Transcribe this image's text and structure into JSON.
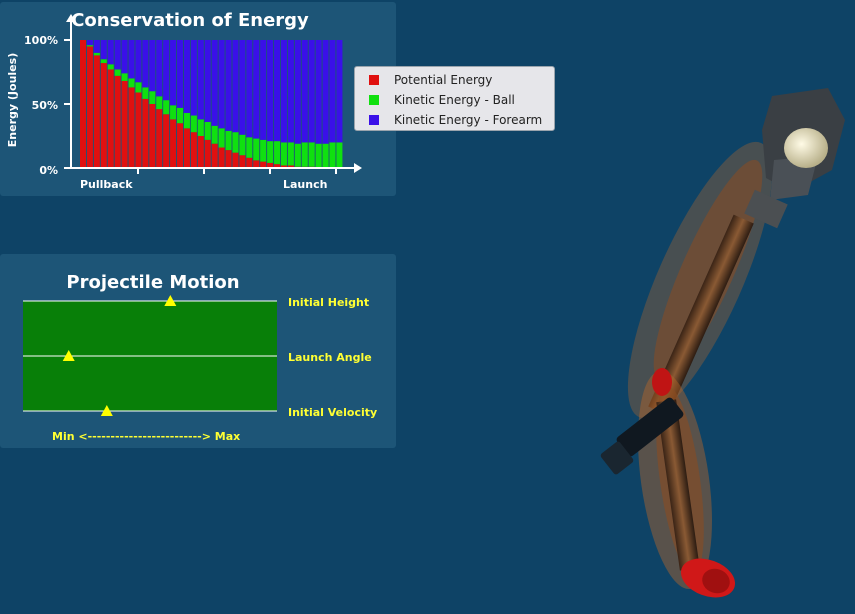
{
  "energy_panel": {
    "title": "Conservation of Energy",
    "ylabel": "Energy (Joules)",
    "x_start_label": "Pullback",
    "x_end_label": "Launch",
    "y_ticks": [
      "100%",
      "50%",
      "0%"
    ]
  },
  "legend": {
    "items": [
      {
        "label": "Potential Energy",
        "color": "#e01010"
      },
      {
        "label": "Kinetic Energy - Ball",
        "color": "#10e010"
      },
      {
        "label": "Kinetic Energy - Forearm",
        "color": "#3a10e8"
      }
    ]
  },
  "chart_data": {
    "type": "bar",
    "stacked": true,
    "title": "Conservation of Energy",
    "xlabel": "",
    "ylabel": "Energy (Joules)",
    "x_tick_labels": [
      "Pullback",
      "Launch"
    ],
    "y_tick_labels": [
      "0%",
      "50%",
      "100%"
    ],
    "ylim": [
      0,
      100
    ],
    "bar_count": 38,
    "series": [
      {
        "name": "Potential Energy",
        "color": "#e01010",
        "values": [
          100,
          95,
          88,
          82,
          77,
          72,
          68,
          63,
          59,
          54,
          50,
          46,
          42,
          38,
          35,
          31,
          28,
          25,
          22,
          19,
          16,
          14,
          12,
          10,
          8,
          6,
          5,
          4,
          3,
          2,
          2,
          1,
          1,
          1,
          0,
          0,
          0,
          0
        ]
      },
      {
        "name": "Kinetic Energy - Ball",
        "color": "#10e010",
        "values": [
          0,
          1,
          2,
          3,
          4,
          5,
          6,
          7,
          8,
          9,
          10,
          10,
          11,
          11,
          12,
          12,
          13,
          13,
          14,
          14,
          15,
          15,
          16,
          16,
          16,
          17,
          17,
          17,
          18,
          18,
          18,
          18,
          19,
          19,
          19,
          19,
          20,
          20
        ]
      },
      {
        "name": "Kinetic Energy - Forearm",
        "color": "#3a10e8",
        "values": [
          0,
          4,
          10,
          15,
          19,
          23,
          26,
          30,
          33,
          37,
          40,
          44,
          47,
          51,
          53,
          57,
          59,
          62,
          64,
          67,
          69,
          71,
          72,
          74,
          76,
          77,
          78,
          79,
          79,
          80,
          80,
          81,
          80,
          80,
          81,
          81,
          80,
          80
        ]
      }
    ]
  },
  "projectile_panel": {
    "title": "Projectile Motion",
    "range_label": "Min <-------------------------> Max",
    "sliders": [
      {
        "label": "Initial Height",
        "value": 0.58
      },
      {
        "label": "Launch Angle",
        "value": 0.18
      },
      {
        "label": "Initial Velocity",
        "value": 0.33
      }
    ]
  },
  "colors": {
    "background": "#0e4366",
    "panel": "#1d5577",
    "slider_field": "#087f08",
    "accent_text": "#ffff33"
  }
}
